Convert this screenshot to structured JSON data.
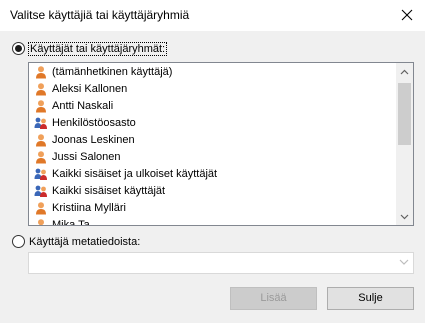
{
  "window": {
    "title": "Valitse käyttäjiä tai käyttäjäryhmiä"
  },
  "options": {
    "users_groups_label": "Käyttäjät tai käyttäjäryhmät:",
    "metadata_label": "Käyttäjä metatiedoista:"
  },
  "users_list": [
    {
      "label": "(tämänhetkinen käyttäjä)",
      "icon": "user-icon"
    },
    {
      "label": "Aleksi Kallonen",
      "icon": "user-icon"
    },
    {
      "label": "Antti Naskali",
      "icon": "user-icon"
    },
    {
      "label": "Henkilöstöosasto",
      "icon": "group-icon"
    },
    {
      "label": "Joonas Leskinen",
      "icon": "user-icon"
    },
    {
      "label": "Jussi Salonen",
      "icon": "user-icon"
    },
    {
      "label": "Kaikki sisäiset ja ulkoiset käyttäjät",
      "icon": "group-icon"
    },
    {
      "label": "Kaikki sisäiset käyttäjät",
      "icon": "group-icon"
    },
    {
      "label": "Kristiina Mylläri",
      "icon": "user-icon"
    },
    {
      "label": "Mika Ta…",
      "icon": "user-icon"
    }
  ],
  "metadata_combo": {
    "value": ""
  },
  "buttons": {
    "add": "Lisää",
    "close": "Sulje"
  },
  "colors": {
    "user_head": "#f0a05a",
    "user_body": "#e07828",
    "group_back": "#3a67b8",
    "group_accent": "#cc2b2b"
  }
}
